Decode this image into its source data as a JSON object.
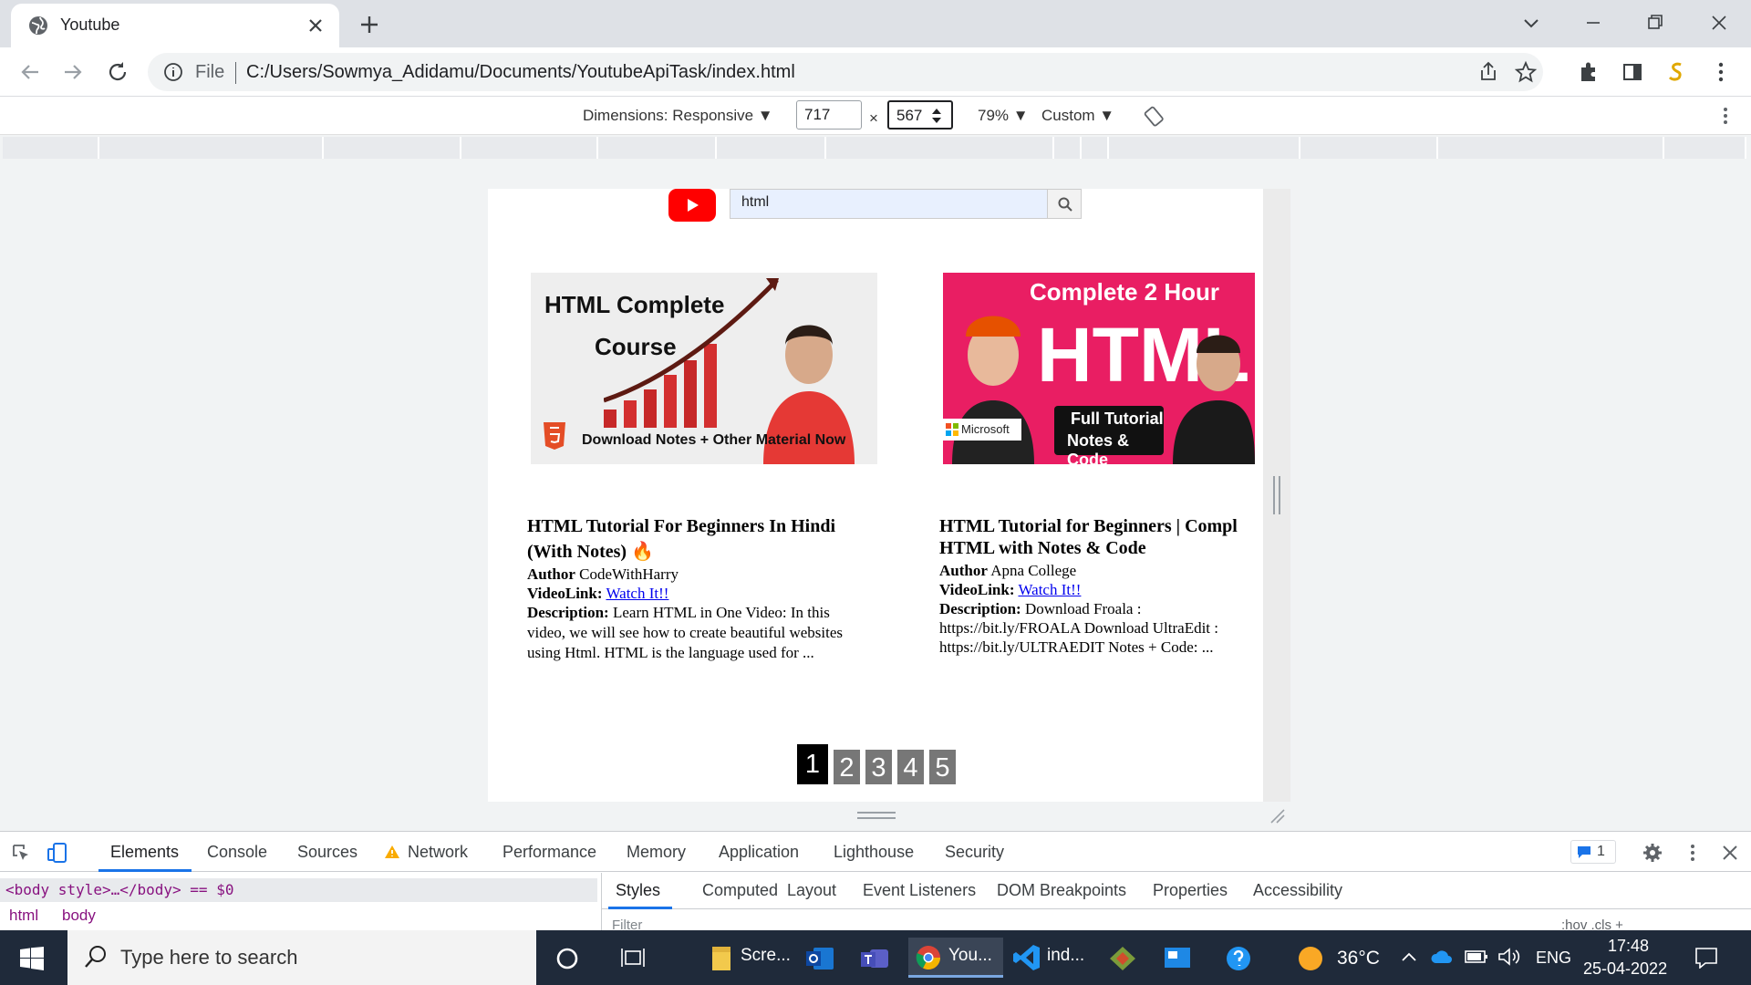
{
  "browser": {
    "tab_title": "Youtube",
    "url_scheme": "File",
    "url": "C:/Users/Sowmya_Adidamu/Documents/YoutubeApiTask/index.html"
  },
  "device_toolbar": {
    "dimensions_label": "Dimensions: Responsive ▼",
    "width": "717",
    "times": "×",
    "height": "567",
    "zoom": "79% ▼",
    "throttle": "Custom ▼"
  },
  "page": {
    "search_value": "html",
    "videos": [
      {
        "thumb_text_1": "HTML Complete",
        "thumb_text_2": "Course",
        "thumb_badge": "HTML",
        "thumb_text_3": "Download Notes + Other Material Now",
        "title_line_1": "HTML Tutorial For Beginners In Hindi",
        "title_line_2": "(With Notes) 🔥",
        "author_label": "Author",
        "author": "CodeWithHarry",
        "link_label": "VideoLink:",
        "link_text": "Watch It!!",
        "desc_label": "Description:",
        "desc_line_1": "Learn HTML in One Video: In this",
        "desc_line_2": "video, we will see how to create beautiful websites",
        "desc_line_3": "using Html. HTML is the language used for ..."
      },
      {
        "thumb_text_1": "Complete 2 Hour",
        "thumb_text_2": "HTML",
        "thumb_badge": "Microsoft",
        "thumb_text_3": "Full Tutorial",
        "thumb_text_4": "Notes & Code",
        "title_line_1": "HTML Tutorial for Beginners | Compl",
        "title_line_2": "HTML with Notes & Code",
        "author_label": "Author",
        "author": "Apna College",
        "link_label": "VideoLink:",
        "link_text": "Watch It!!",
        "desc_label": "Description:",
        "desc_line_1": "Download Froala :",
        "desc_line_2": "https://bit.ly/FROALA Download UltraEdit :",
        "desc_line_3": "https://bit.ly/ULTRAEDIT Notes + Code: ..."
      }
    ],
    "pages": [
      "1",
      "2",
      "3",
      "4",
      "5"
    ],
    "active_page": "1"
  },
  "devtools": {
    "tabs": [
      "Elements",
      "Console",
      "Sources",
      "Network",
      "Performance",
      "Memory",
      "Application",
      "Lighthouse",
      "Security"
    ],
    "issues_count": "1",
    "dom_line": "<body style>…</body> == $0",
    "breadcrumbs": [
      "html",
      "body"
    ],
    "side_tabs": [
      "Styles",
      "Computed",
      "Layout",
      "Event Listeners",
      "DOM Breakpoints",
      "Properties",
      "Accessibility"
    ],
    "filter_placeholder": "Filter",
    "filter_right": ":hov  .cls  +"
  },
  "taskbar": {
    "search_placeholder": "Type here to search",
    "apps": [
      {
        "label": "Scre..."
      },
      {
        "label": "You..."
      },
      {
        "label": "ind..."
      }
    ],
    "temperature": "36°C",
    "language": "ENG",
    "time": "17:48",
    "date": "25-04-2022"
  },
  "colors": {
    "accent": "#1a73e8",
    "youtube_red": "#ff0000",
    "taskbar": "#1f2a3a"
  }
}
